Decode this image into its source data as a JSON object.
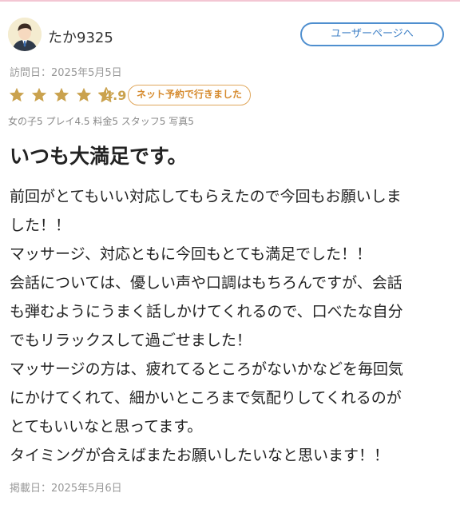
{
  "user": {
    "name": "たか9325",
    "page_button": "ユーザーページへ"
  },
  "visit": {
    "label": "訪問日：2025年5月5日"
  },
  "rating": {
    "value": "4.9",
    "stars_filled": 4.5,
    "star_color": "#caa24e",
    "badge": "ネット予約で行きました"
  },
  "scores": {
    "text": "女の子5 プレイ4.5 料金5 スタッフ5 写真5"
  },
  "review": {
    "title": "いつも大満足です。",
    "lines": [
      "前回がとてもいい対応してもらえたので今回もお願いしま",
      "した！！",
      "マッサージ、対応ともに今回もとても満足でした！！",
      "会話については、優しい声や口調はもちろんですが、会話",
      "も弾むようにうまく話しかけてくれるので、口べたな自分",
      "でもリラックスして過ごせました！",
      "マッサージの方は、疲れてるところがないかなどを毎回気",
      "にかけてくれて、細かいところまで気配りしてくれるのが",
      "とてもいいなと思ってます。",
      "タイミングが合えばまたお願いしたいなと思います！！"
    ]
  },
  "posted": {
    "label": "掲載日：2025年5月6日"
  }
}
